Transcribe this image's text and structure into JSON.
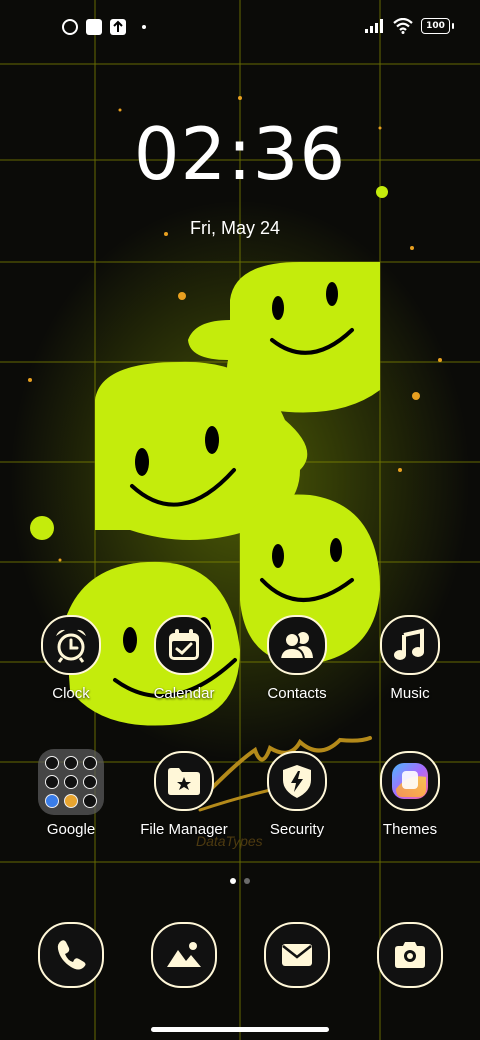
{
  "status_bar": {
    "battery": "100"
  },
  "lockscreen": {
    "time": "02:36",
    "date": "Fri, May 24"
  },
  "apps_row1": [
    {
      "label": "Clock",
      "icon": "alarm-clock-icon"
    },
    {
      "label": "Calendar",
      "icon": "calendar-check-icon"
    },
    {
      "label": "Contacts",
      "icon": "contacts-icon"
    },
    {
      "label": "Music",
      "icon": "music-note-icon"
    }
  ],
  "apps_row2": [
    {
      "label": "Google",
      "icon": "google-folder-icon"
    },
    {
      "label": "File Manager",
      "icon": "folder-star-icon"
    },
    {
      "label": "Security",
      "icon": "shield-bolt-icon"
    },
    {
      "label": "Themes",
      "icon": "themes-icon"
    }
  ],
  "dock": [
    {
      "icon": "phone-icon"
    },
    {
      "icon": "gallery-icon"
    },
    {
      "icon": "mail-icon"
    },
    {
      "icon": "camera-icon"
    }
  ],
  "colors": {
    "icon_fg": "#fff7d8",
    "smiley": "#c8f000",
    "grid": "#9aa000"
  },
  "wallpaper": {
    "signature": "DataTypes"
  }
}
